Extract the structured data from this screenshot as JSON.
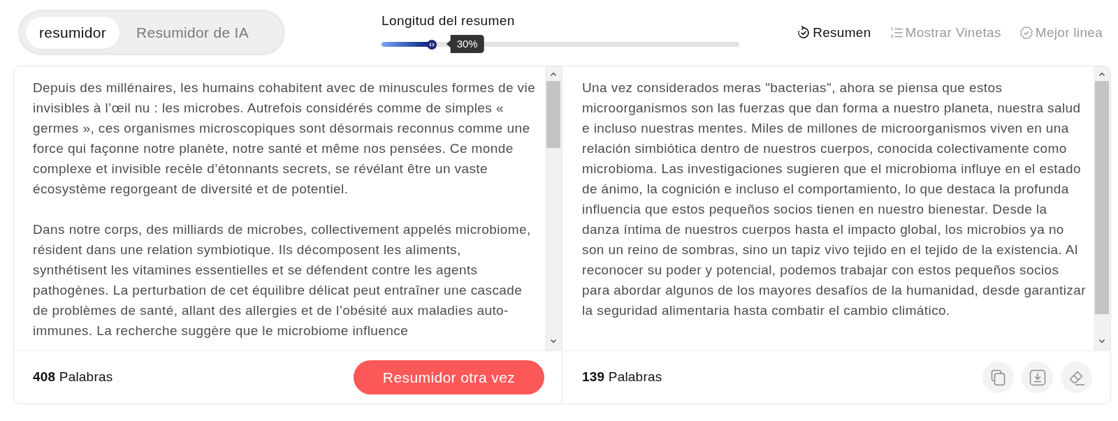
{
  "mode_tabs": [
    {
      "label": "resumidor",
      "selected": true
    },
    {
      "label": "Resumidor de IA",
      "selected": false
    }
  ],
  "length_slider": {
    "label": "Longitud del resumen",
    "level": 0.14,
    "reading": "30%"
  },
  "toolbar": [
    {
      "kind": "summary",
      "label": "Resumen",
      "selected": true
    },
    {
      "kind": "bullets",
      "label": "Mostrar Vinetas",
      "selected": false
    },
    {
      "kind": "bestline",
      "label": "Mejor linea",
      "selected": false
    }
  ],
  "input_panel": {
    "paragraphs": [
      "Depuis des millénaires, les humains cohabitent avec de minuscules formes de vie invisibles à l’œil nu : les microbes. Autrefois considérés comme de simples « germes », ces organismes microscopiques sont désormais reconnus comme une force qui façonne notre planète, notre santé et même nos pensées. Ce monde complexe et invisible recèle d’étonnants secrets, se révélant être un vaste écosystème regorgeant de diversité et de potentiel.",
      "Dans notre corps, des milliards de microbes, collectivement appelés microbiome, résident dans une relation symbiotique. Ils décomposent les aliments, synthétisent les vitamines essentielles et se défendent contre les agents pathogènes. La perturbation de cet équilibre délicat peut entraîner une cascade de problèmes de santé, allant des allergies et de l’obésité aux maladies auto-immunes. La recherche suggère que le microbiome influence"
    ],
    "word_count": "**408** Palabras",
    "button": "Resumidor otra vez"
  },
  "output_panel": {
    "paragraphs": [
      "Una vez considerados meras \"bacterias\", ahora se piensa que estos microorganismos son las fuerzas que dan forma a nuestro planeta, nuestra salud e incluso nuestras mentes. Miles de millones de microorganismos viven en una relación simbiótica dentro de nuestros cuerpos, conocida colectivamente como microbioma. Las investigaciones sugieren que el microbioma influye en el estado de ánimo, la cognición e incluso el comportamiento, lo que destaca la profunda influencia que estos pequeños socios tienen en nuestro bienestar. Desde la danza íntima de nuestros cuerpos hasta el impacto global, los microbios ya no son un reino de sombras, sino un tapiz vivo tejido en el tejido de la existencia. Al reconocer su poder y potencial, podemos trabajar con estos pequeños socios para abordar algunos de los mayores desafíos de la humanidad, desde garantizar la seguridad alimentaria hasta combatir el cambio climático."
    ],
    "word_count": "**139** Palabras"
  }
}
